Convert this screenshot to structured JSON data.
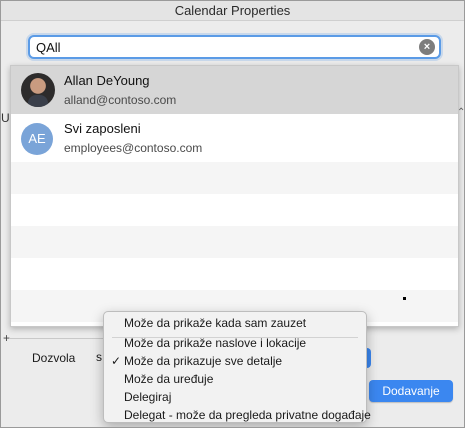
{
  "window": {
    "title": "Calendar Properties"
  },
  "search": {
    "value": "QAll",
    "clear_icon": "clear-circle-icon"
  },
  "results": [
    {
      "name": "Allan DeYoung",
      "email": "alland@contoso.com",
      "avatar": "photo",
      "selected": true
    },
    {
      "name": "Svi zaposleni",
      "email": "employees@contoso.com",
      "avatar_initials": "AE",
      "selected": false
    }
  ],
  "background": {
    "left_fragment": "U",
    "plus": "+",
    "permission_label": "Dozvola",
    "s_fragment": "s",
    "add_button": "Dodavanje"
  },
  "permission_menu": {
    "items": [
      {
        "label": "Može da prikaže kada sam zauzet",
        "checked": false
      },
      {
        "label": "Može da prikaže naslove i lokacije",
        "checked": false
      },
      {
        "label": "Može da prikazuje sve detalje",
        "checked": true
      },
      {
        "label": "Može da uređuje",
        "checked": false
      },
      {
        "label": "Delegiraj",
        "checked": false
      },
      {
        "label": "Delegat - može da pregleda privatne događaje",
        "checked": false
      }
    ],
    "check_mark": "✓"
  },
  "colors": {
    "accent": "#3b87f0",
    "selected_row": "#d6d6d6",
    "initials_avatar": "#7aa4d8"
  }
}
